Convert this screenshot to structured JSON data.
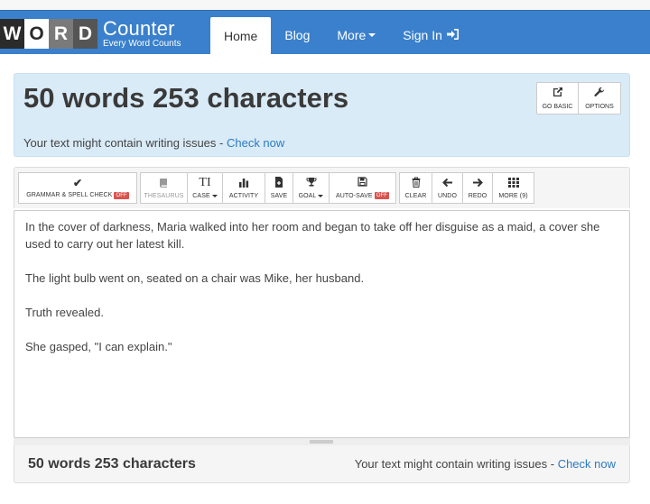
{
  "logo": {
    "letters": [
      "W",
      "O",
      "R",
      "D"
    ],
    "name": "Counter",
    "tagline": "Every Word Counts"
  },
  "nav": {
    "items": [
      {
        "label": "Home",
        "active": true
      },
      {
        "label": "Blog"
      },
      {
        "label": "More"
      },
      {
        "label": "Sign In",
        "icon": "sign-in-icon"
      }
    ]
  },
  "stats": {
    "summary": "50 words 253 characters",
    "issues_text": "Your text might contain writing issues - ",
    "issues_link": "Check now"
  },
  "header_buttons": [
    {
      "label": "GO BASIC",
      "icon": "external-link-icon"
    },
    {
      "label": "OPTIONS",
      "icon": "wrench-icon"
    }
  ],
  "toolbar": [
    {
      "label": "GRAMMAR & SPELL CHECK",
      "badge": "OFF",
      "icon": "check-icon"
    },
    {
      "label": "THESAURUS",
      "icon": "book-icon"
    },
    {
      "label": "CASE",
      "icon": "text-case-icon"
    },
    {
      "label": "ACTIVITY",
      "icon": "bar-chart-icon"
    },
    {
      "label": "SAVE",
      "icon": "file-save-icon"
    },
    {
      "label": "GOAL",
      "icon": "trophy-icon"
    },
    {
      "label": "AUTO-SAVE",
      "badge": "OFF",
      "icon": "floppy-disk-icon"
    },
    {
      "label": "CLEAR",
      "icon": "trash-icon"
    },
    {
      "label": "UNDO",
      "icon": "arrow-left-icon"
    },
    {
      "label": "REDO",
      "icon": "arrow-right-icon"
    },
    {
      "label": "MORE (9)",
      "icon": "grid-icon"
    }
  ],
  "editor": {
    "paragraphs": [
      "In the cover of darkness, Maria walked into her room and began to take off her disguise as a maid, a cover she used to carry out her latest kill.",
      "The light bulb went on, seated on a chair was Mike, her husband.",
      "Truth revealed.",
      "She gasped, \"I can explain.\""
    ]
  },
  "colors": {
    "navbar": "#3a80cc",
    "hero_bg": "#d9ebf7",
    "link": "#2b7bc2",
    "off_badge": "#d9534f"
  }
}
